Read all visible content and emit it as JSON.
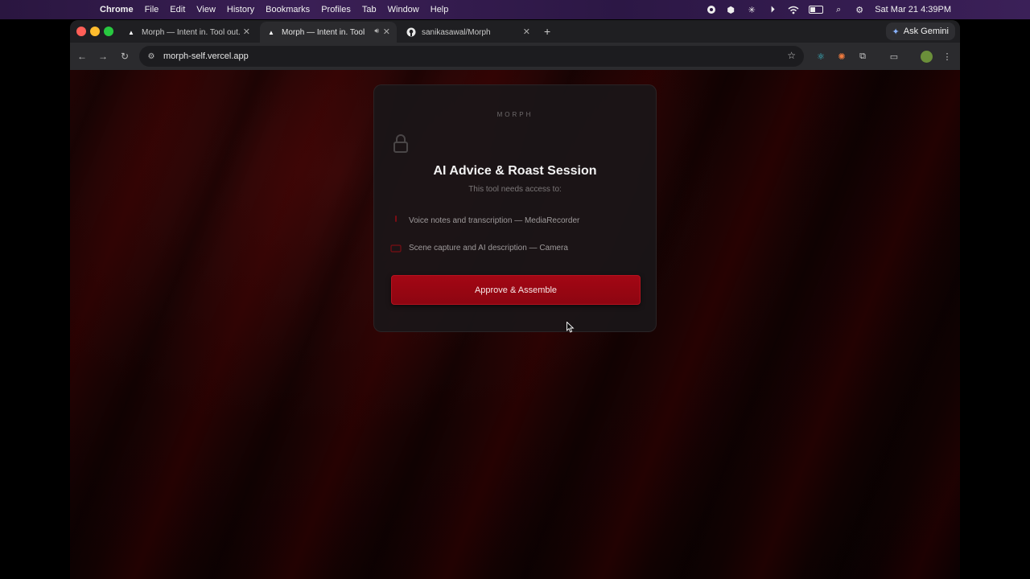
{
  "menubar": {
    "app": "Chrome",
    "items": [
      "File",
      "Edit",
      "View",
      "History",
      "Bookmarks",
      "Profiles",
      "Tab",
      "Window",
      "Help"
    ],
    "datetime": "Sat Mar 21  4:39PM"
  },
  "tabs": [
    {
      "title": "Morph — Intent in. Tool out.",
      "active": false
    },
    {
      "title": "Morph — Intent in. Tool out.",
      "active": true
    },
    {
      "title": "sanikasawal/Morph",
      "active": false
    }
  ],
  "ask_gemini": "Ask Gemini",
  "address": {
    "url": "morph-self.vercel.app"
  },
  "card": {
    "brand": "MORPH",
    "title": "AI Advice & Roast Session",
    "subtitle": "This tool needs access to:",
    "permissions": [
      {
        "label": "Voice notes and transcription — MediaRecorder",
        "icon": "microphone-icon"
      },
      {
        "label": "Scene capture and AI description — Camera",
        "icon": "camera-icon"
      }
    ],
    "approve_label": "Approve & Assemble"
  },
  "colors": {
    "accent": "#9a0612",
    "background": "#1a0303",
    "card": "#1a1618"
  }
}
